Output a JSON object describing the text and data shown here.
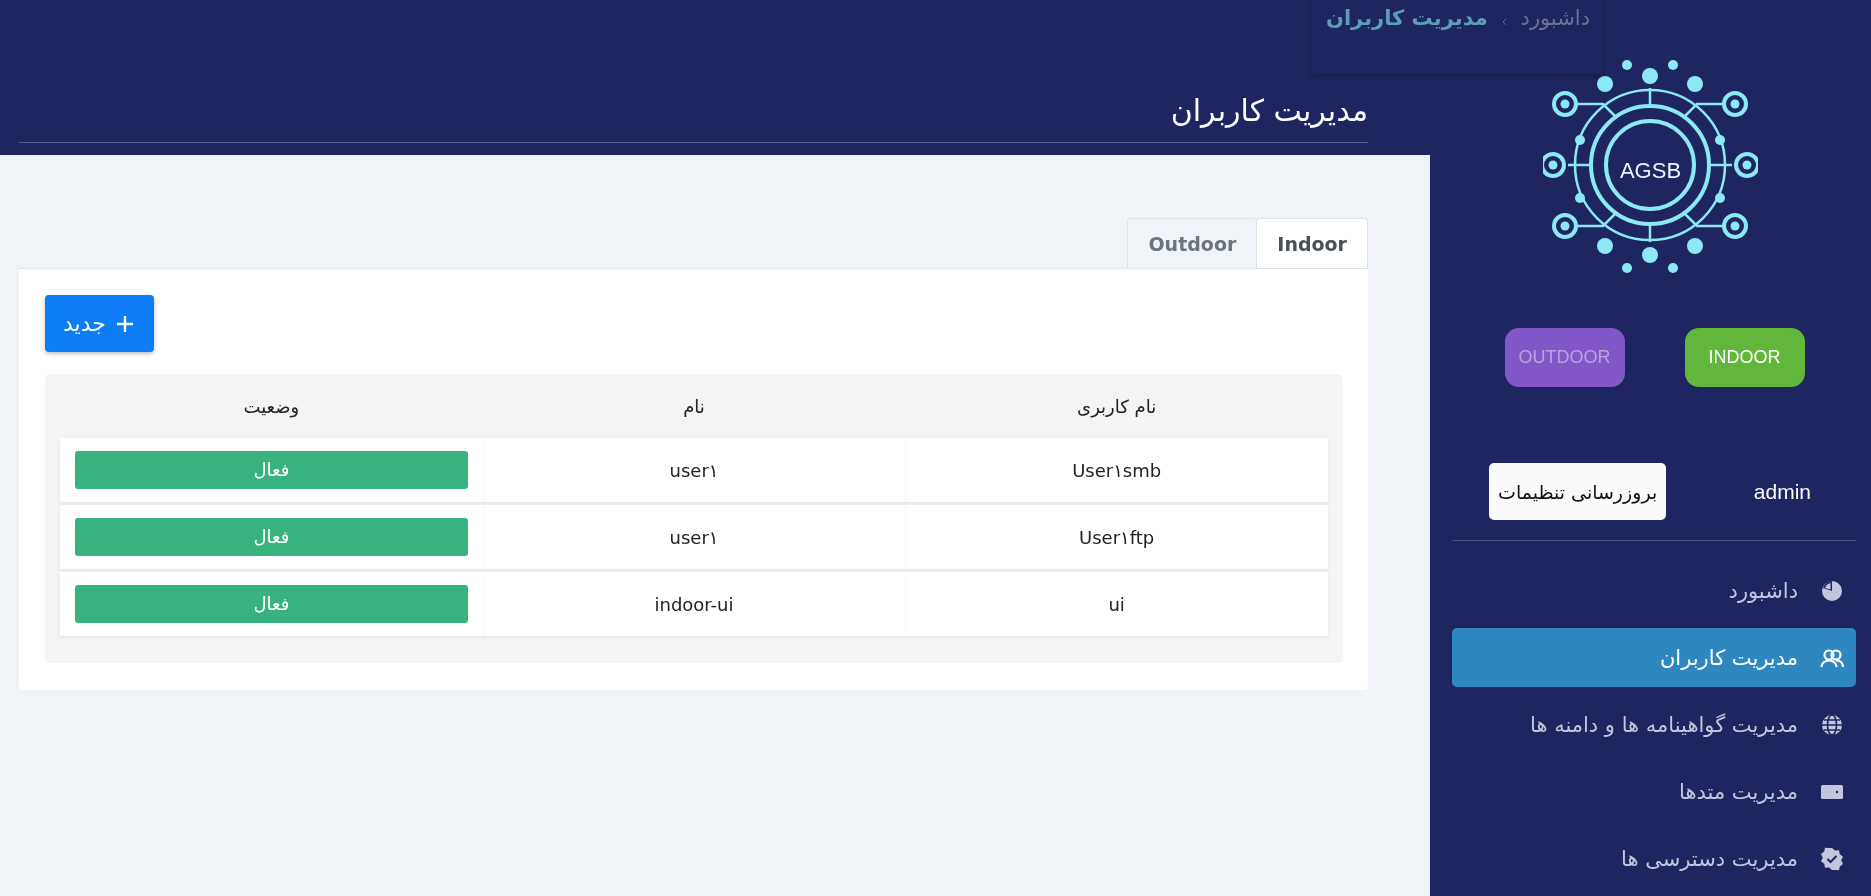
{
  "breadcrumb": [
    {
      "label": "داشبورد",
      "current": false
    },
    {
      "label": "مدیریت کاربران",
      "current": true
    }
  ],
  "page_title": "مدیریت کاربران",
  "tabs": [
    {
      "label": "Indoor",
      "selected": true
    },
    {
      "label": "Outdoor",
      "selected": false
    }
  ],
  "new_button": "جدید",
  "table": {
    "columns": [
      "نام کاربری",
      "نام",
      "وضعیت"
    ],
    "rows": [
      {
        "username": "User۱smb",
        "name": "user۱",
        "status": "فعال"
      },
      {
        "username": "User۱ftp",
        "name": "user۱",
        "status": "فعال"
      },
      {
        "username": "ui",
        "name": "indoor-ui",
        "status": "فعال"
      }
    ]
  },
  "sidebar": {
    "logo_text": "AGSB",
    "modes": [
      {
        "label": "INDOOR",
        "selected": true
      },
      {
        "label": "OUTDOOR",
        "selected": false
      }
    ],
    "user": "admin",
    "settings_button": "بروزرسانی تنظیمات",
    "menu": [
      {
        "label": "داشبورد",
        "kind": "chart",
        "selected": false
      },
      {
        "label": "مدیریت کاربران",
        "kind": "users",
        "selected": true
      },
      {
        "label": "مدیریت گواهینامه ها و دامنه ها",
        "kind": "globe",
        "selected": false
      },
      {
        "label": "مدیریت متدها",
        "kind": "card",
        "selected": false
      },
      {
        "label": "مدیریت دسترسی ها",
        "kind": "badge",
        "selected": false
      }
    ]
  }
}
